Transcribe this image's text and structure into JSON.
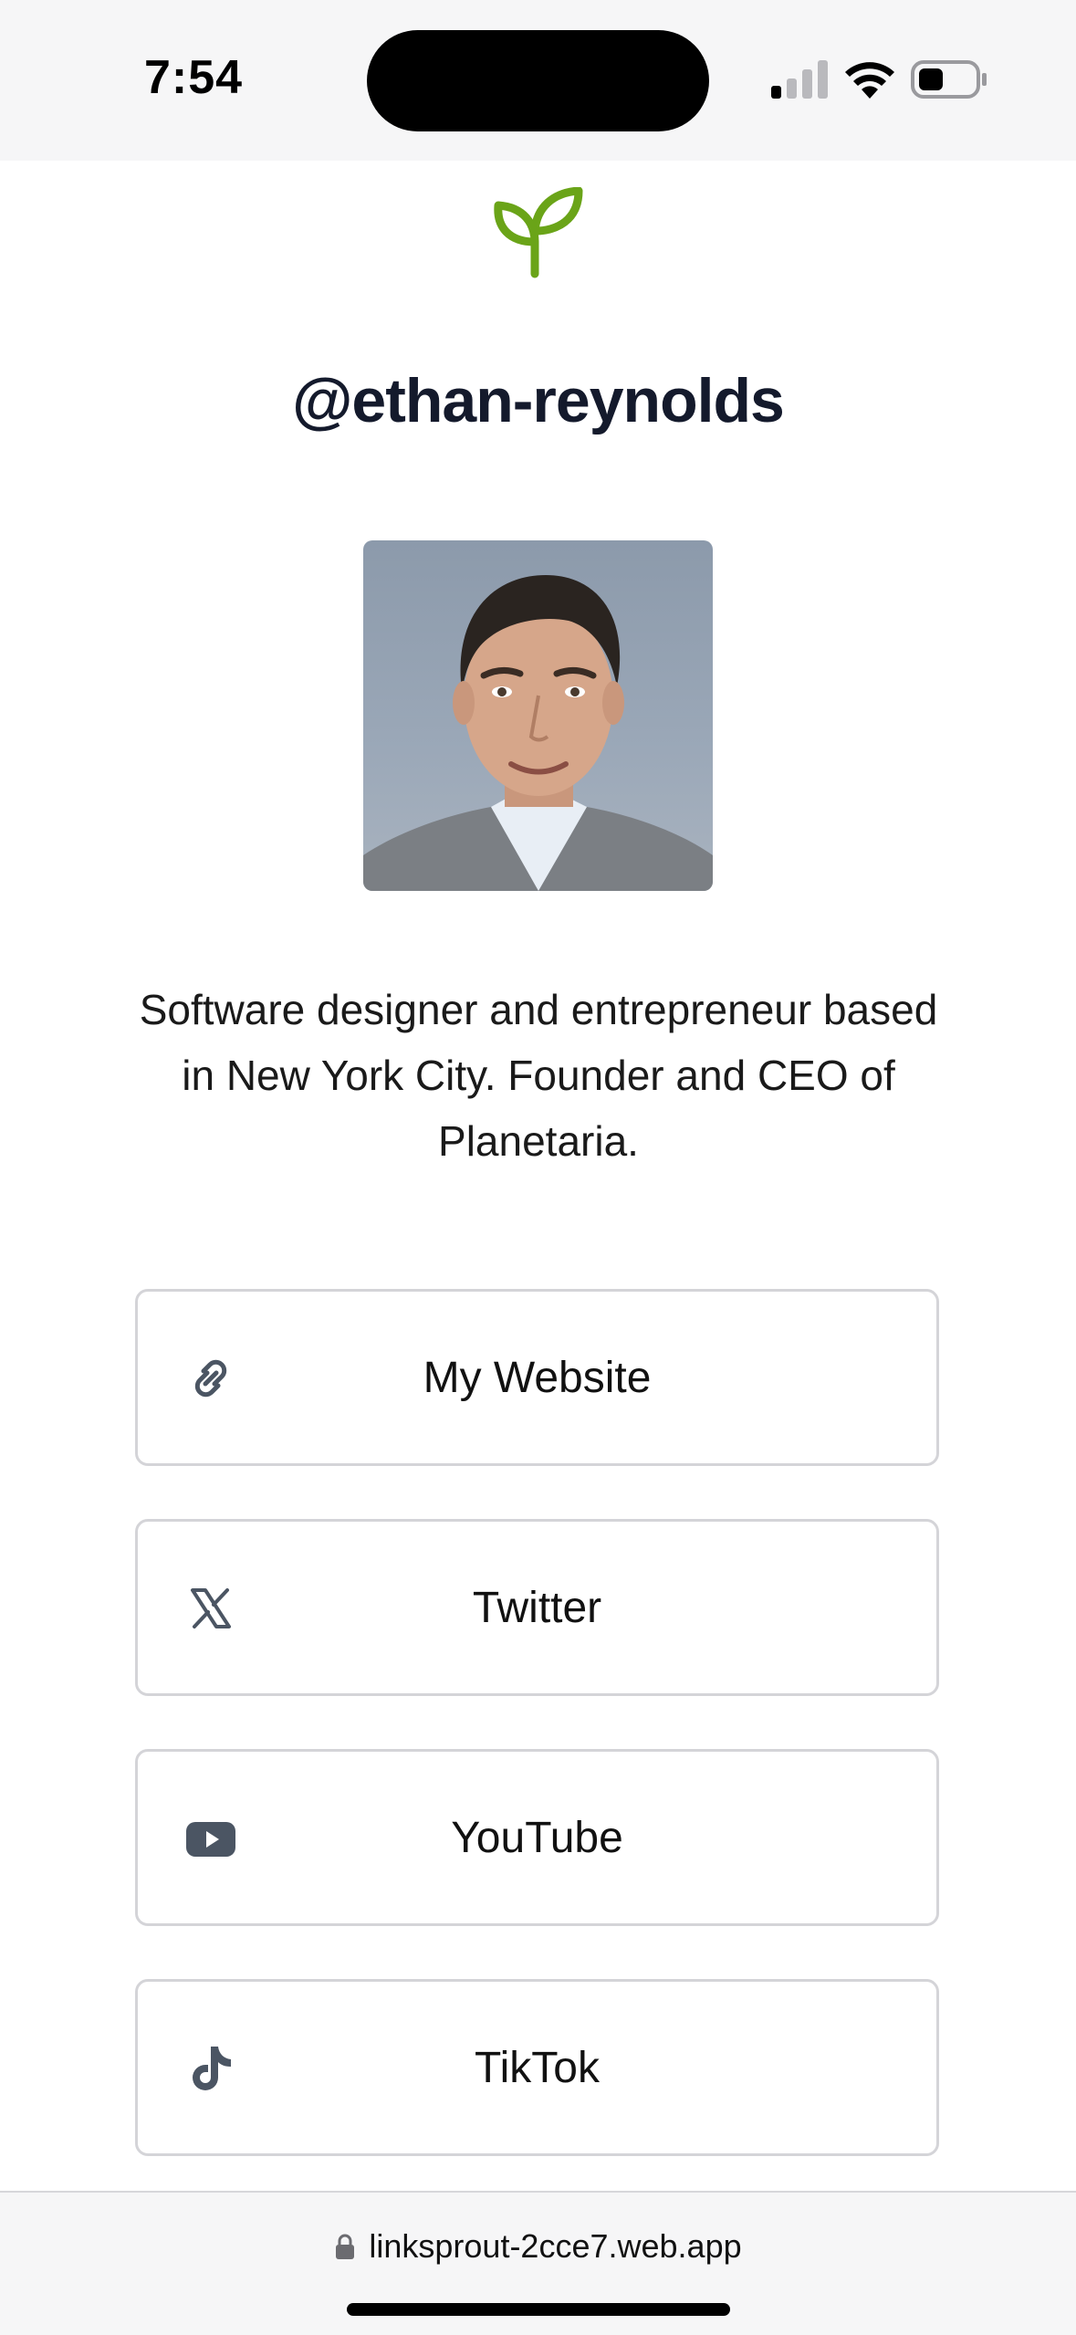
{
  "status": {
    "time": "7:54"
  },
  "profile": {
    "username": "@ethan-reynolds",
    "bio": "Software designer and entrepreneur based in New York City. Founder and CEO of Planetaria."
  },
  "links": [
    {
      "label": "My Website",
      "icon": "link-icon"
    },
    {
      "label": "Twitter",
      "icon": "x-icon"
    },
    {
      "label": "YouTube",
      "icon": "youtube-icon"
    },
    {
      "label": "TikTok",
      "icon": "tiktok-icon"
    }
  ],
  "browser": {
    "url": "linksprout-2cce7.web.app"
  },
  "colors": {
    "accent": "#6aa418",
    "heading": "#141a2c",
    "border": "#d4d4d8",
    "icon": "#4b5563"
  }
}
